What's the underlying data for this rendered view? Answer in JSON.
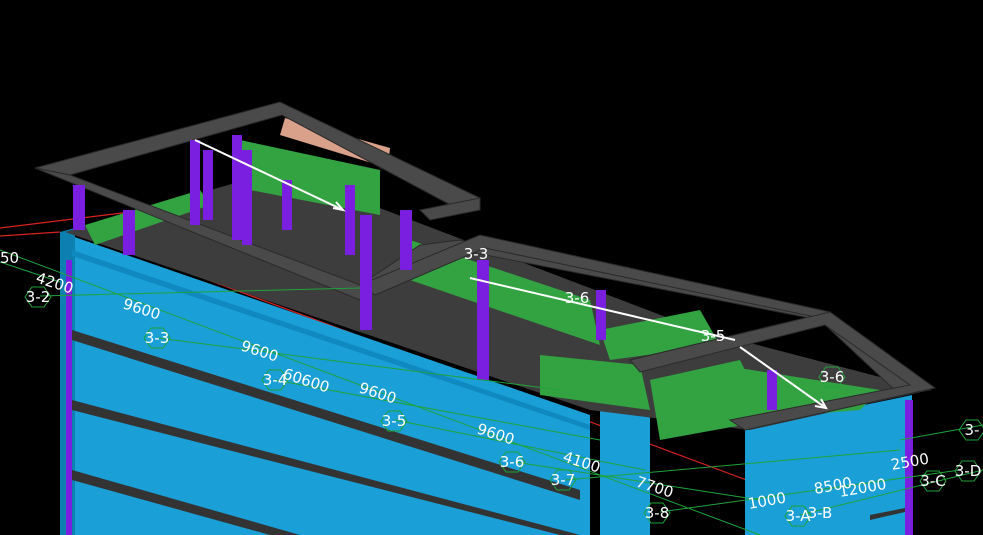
{
  "view": {
    "background": "#000000",
    "colors": {
      "facade": "#1a9fd6",
      "facade_dark": "#0d7fb0",
      "column": "#7a1fe0",
      "slab": "#3d3d3d",
      "roof_green": "#33a342",
      "grid_line": "#1fa33a",
      "red_line": "#d8231f",
      "skylight": "#d9a08a"
    }
  },
  "grid_axes": [
    {
      "label": "3-2"
    },
    {
      "label": "3-3"
    },
    {
      "label": "3-4"
    },
    {
      "label": "3-5"
    },
    {
      "label": "3-6"
    },
    {
      "label": "3-7"
    },
    {
      "label": "3-8"
    },
    {
      "label": "3-A"
    },
    {
      "label": "3-B"
    },
    {
      "label": "3-C"
    },
    {
      "label": "3-D"
    },
    {
      "label": "3-6"
    },
    {
      "label": "3-3"
    },
    {
      "label": "3-5"
    },
    {
      "label": "3-6"
    },
    {
      "label": "3-"
    }
  ],
  "dimensions": [
    {
      "text": "4200"
    },
    {
      "text": "9600"
    },
    {
      "text": "9600"
    },
    {
      "text": "60600"
    },
    {
      "text": "9600"
    },
    {
      "text": "9600"
    },
    {
      "text": "4100"
    },
    {
      "text": "7700"
    },
    {
      "text": "1000"
    },
    {
      "text": "8500"
    },
    {
      "text": "12000"
    },
    {
      "text": "2500"
    },
    {
      "text": "50"
    }
  ]
}
